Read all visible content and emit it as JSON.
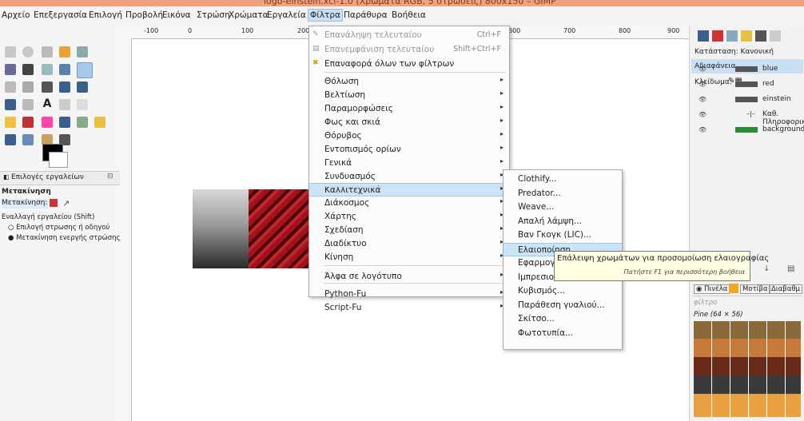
{
  "window": {
    "title": "logo-einstein.xcf-1.0 (Χρώματα RGB, 5 στρώσεις) 800x150 – GIMP"
  },
  "menubar": [
    "Αρχείο",
    "Επεξεργασία",
    "Επιλογή",
    "Προβολή",
    "Εικόνα",
    "Στρώση",
    "Χρώματα",
    "Εργαλεία",
    "Φίλτρα",
    "Παράθυρα",
    "Βοήθεια"
  ],
  "toolbox": {
    "options_tab": "Επιλογές εργαλείων",
    "tool_name": "Μετακίνηση",
    "mode_label": "Μετακίνηση:",
    "toggle_label": "Εναλλαγή εργαλείου (Shift)",
    "option1": "Επιλογή στρωσης ή οδηγού",
    "option2": "Μετακίνηση ενεργής στρώσης"
  },
  "ruler": {
    "marks": [
      "-100",
      "0",
      "100",
      "200",
      "600",
      "700",
      "800",
      "900"
    ]
  },
  "filters_menu": {
    "items": [
      {
        "label": "Επανάληψη τελευταίου",
        "shortcut": "Ctrl+F",
        "disabled": true
      },
      {
        "label": "Επανεμφάνιση τελευταίου",
        "shortcut": "Shift+Ctrl+F",
        "disabled": true
      },
      {
        "label": "Επαναφορά όλων των φίλτρων",
        "shortcut": "",
        "disabled": false
      },
      {
        "label": "Θόλωση",
        "submenu": true
      },
      {
        "label": "Βελτίωση",
        "submenu": true
      },
      {
        "label": "Παραμορφώσεις",
        "submenu": true
      },
      {
        "label": "Φως και σκιά",
        "submenu": true
      },
      {
        "label": "Θόρυβος",
        "submenu": true
      },
      {
        "label": "Εντοπισμός ορίων",
        "submenu": true
      },
      {
        "label": "Γενικά",
        "submenu": true
      },
      {
        "label": "Συνδυασμός",
        "submenu": true
      },
      {
        "label": "Καλλιτεχνικά",
        "submenu": true,
        "highlight": true
      },
      {
        "label": "Διάκοσμος",
        "submenu": true
      },
      {
        "label": "Χάρτης",
        "submenu": true
      },
      {
        "label": "Σχεδίαση",
        "submenu": true
      },
      {
        "label": "Διαδίκτυο",
        "submenu": true
      },
      {
        "label": "Κίνηση",
        "submenu": true
      },
      {
        "label": "Άλφα σε λογότυπο",
        "submenu": true
      },
      {
        "label": "Python-Fu",
        "submenu": true
      },
      {
        "label": "Script-Fu",
        "submenu": true
      }
    ]
  },
  "artistic_menu": {
    "items": [
      "Clothify...",
      "Predator...",
      "Weave...",
      "Απαλή λάμψη...",
      "Βαν Γκογκ (LIC)...",
      "Ελαιοποίηση...",
      "Εφαρμογή",
      "Ιμπρεσιον",
      "Κυβισμός...",
      "Παράθεση γυαλιού...",
      "Σκίτσο...",
      "Φωτοτυπία..."
    ]
  },
  "tooltip": {
    "text": "Επάλειψη χρωμάτων για προσομοίωση ελαιογραφίας",
    "hint": "Πατήστε F1 για περισσότερη βοήθεια"
  },
  "layers": {
    "mode_label": "Κατάσταση: Κανονική",
    "opacity_label": "Αδιαφάνεια",
    "lock_label": "Κλείδωμα:",
    "rows": [
      "blue",
      "red",
      "einstein",
      "Καθ. Πληροφορική",
      "background"
    ]
  },
  "patterns": {
    "tabs": [
      "Πινέλα",
      "Μοτίβα",
      "Διαβαθμ"
    ],
    "filter_placeholder": "φίλτρο",
    "selected": "Pine (64 × 56)"
  },
  "colors": {
    "accent": "#cce4f7",
    "titlebar": "#f1a17e"
  }
}
